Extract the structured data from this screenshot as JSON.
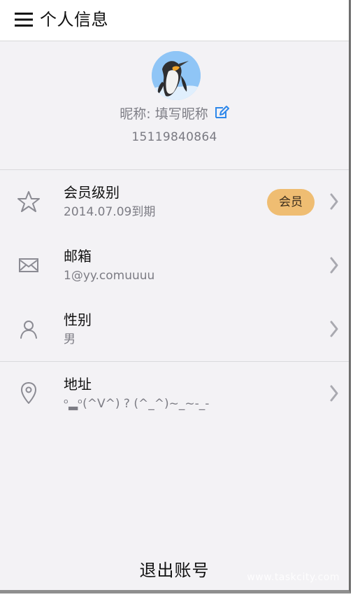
{
  "header": {
    "title": "个人信息",
    "menu_icon": "menu-icon"
  },
  "profile": {
    "avatar_icon": "penguin-avatar",
    "nickname": "昵称: 填写昵称",
    "edit_icon": "edit-icon",
    "phone": "15119840864"
  },
  "list": [
    {
      "icon": "star-icon",
      "title": "会员级别",
      "subtitle": "2014.07.09到期",
      "badge": "会员",
      "chevron_icon": "chevron-right-icon"
    },
    {
      "icon": "mail-icon",
      "title": "邮箱",
      "subtitle": "1@yy.comuuuu",
      "chevron_icon": "chevron-right-icon"
    },
    {
      "icon": "user-icon",
      "title": "性别",
      "subtitle": "男",
      "chevron_icon": "chevron-right-icon"
    },
    {
      "icon": "location-pin-icon",
      "title": "地址",
      "subtitle": "ᵒ▂ᵒ(^V^) ? (^_^)~_~-_-",
      "chevron_icon": "chevron-right-icon"
    }
  ],
  "footer": {
    "logout_label": "退出账号"
  },
  "watermark": {
    "text": "www.taskcity.com"
  },
  "colors": {
    "background": "#f3f2f5",
    "header_background": "#ffffff",
    "badge": "#efbd72",
    "edit_icon": "#2e88ea",
    "muted_text": "#7c7c84"
  }
}
